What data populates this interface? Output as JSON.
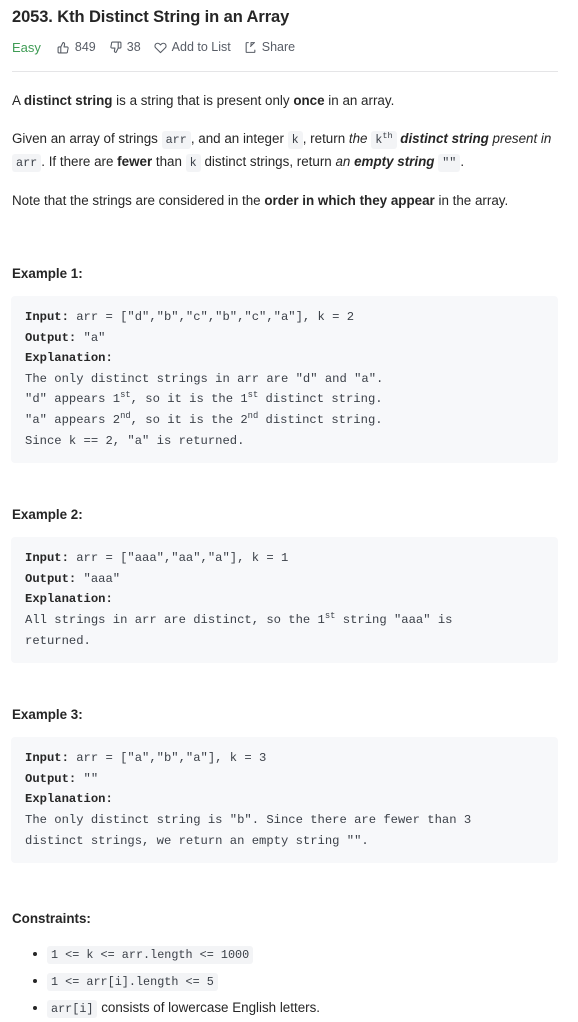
{
  "problem": {
    "title": "2053. Kth Distinct String in an Array",
    "difficulty": "Easy",
    "likes": "849",
    "dislikes": "38",
    "add_to_list_label": "Add to List",
    "share_label": "Share"
  },
  "description": {
    "p1": {
      "t1": "A ",
      "b1": "distinct string",
      "t2": " is a string that is present only ",
      "b2": "once",
      "t3": " in an array."
    },
    "p2": {
      "t1": "Given an array of strings ",
      "c1": "arr",
      "t2": ", and an integer ",
      "c2": "k",
      "t3": ", return ",
      "i1": "the",
      "t4": " ",
      "c3": "k",
      "c3sup": "th",
      "t5": " ",
      "bi1": "distinct string",
      "t6": " ",
      "i2": "present in",
      "t7": " ",
      "c4": "arr",
      "t8": ". If there are ",
      "b1": "fewer",
      "t9": " than ",
      "c5": "k",
      "t10": " distinct strings, return ",
      "i3": "an",
      "t11": " ",
      "bi2": "empty string",
      "t12": " ",
      "c6": "\"\"",
      "t13": "."
    },
    "p3": {
      "t1": "Note that the strings are considered in the ",
      "b1": "order in which they appear",
      "t2": " in the array."
    }
  },
  "examples": [
    {
      "heading": "Example 1:",
      "input_label": "Input:",
      "input_value": " arr = [\"d\",\"b\",\"c\",\"b\",\"c\",\"a\"], k = 2",
      "output_label": "Output:",
      "output_value": " \"a\"",
      "explanation_label": "Explanation:",
      "explanation_lines": [
        {
          "pre": "The only distinct strings in arr are \"d\" and \"a\"."
        },
        {
          "pre": "\"d\" appears 1",
          "sup": "st",
          "mid": ", so it is the 1",
          "sup2": "st",
          "post": " distinct string."
        },
        {
          "pre": "\"a\" appears 2",
          "sup": "nd",
          "mid": ", so it is the 2",
          "sup2": "nd",
          "post": " distinct string."
        },
        {
          "pre": "Since k == 2, \"a\" is returned."
        }
      ]
    },
    {
      "heading": "Example 2:",
      "input_label": "Input:",
      "input_value": " arr = [\"aaa\",\"aa\",\"a\"], k = 1",
      "output_label": "Output:",
      "output_value": " \"aaa\"",
      "explanation_label": "Explanation:",
      "explanation_lines": [
        {
          "pre": "All strings in arr are distinct, so the 1",
          "sup": "st",
          "mid": " string \"aaa\" is\nreturned."
        }
      ]
    },
    {
      "heading": "Example 3:",
      "input_label": "Input:",
      "input_value": " arr = [\"a\",\"b\",\"a\"], k = 3",
      "output_label": "Output:",
      "output_value": " \"\"",
      "explanation_label": "Explanation:",
      "explanation_lines": [
        {
          "pre": "The only distinct string is \"b\". Since there are fewer than 3\ndistinct strings, we return an empty string \"\"."
        }
      ]
    }
  ],
  "constraints": {
    "heading": "Constraints:",
    "items": [
      {
        "code": "1 <= k <= arr.length <= 1000",
        "text": ""
      },
      {
        "code": "1 <= arr[i].length <= 5",
        "text": ""
      },
      {
        "code": "arr[i]",
        "text": " consists of lowercase English letters."
      }
    ]
  },
  "icons": {
    "thumbs_up": "thumbs-up-icon",
    "thumbs_down": "thumbs-down-icon",
    "heart": "heart-icon",
    "share": "share-icon"
  }
}
